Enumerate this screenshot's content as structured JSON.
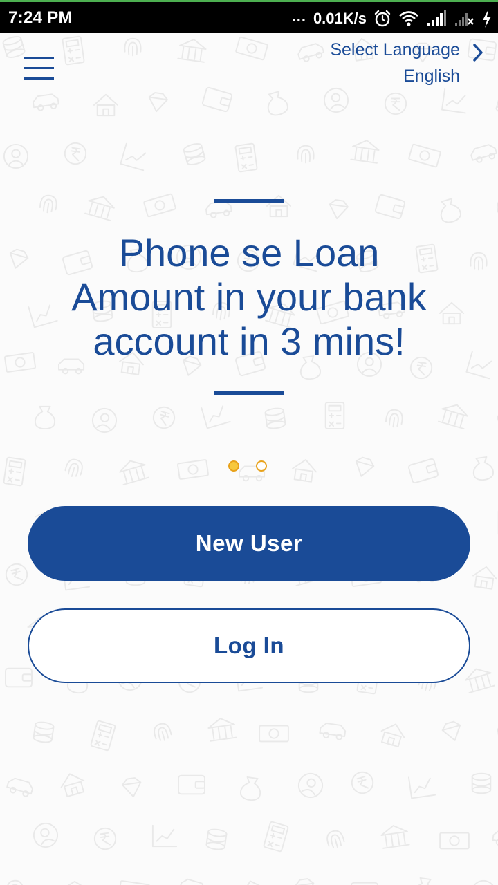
{
  "status_bar": {
    "time": "7:24 PM",
    "dots": "...",
    "net_speed": "0.01K/s",
    "icons": [
      "alarm-icon",
      "wifi-icon",
      "signal-icon",
      "signal-off-icon",
      "charging-icon"
    ]
  },
  "header": {
    "menu_icon": "hamburger-menu-icon",
    "language": {
      "label": "Select Language",
      "value": "English",
      "icon": "chevron-right-icon"
    }
  },
  "hero": {
    "title": "Phone se Loan\nAmount in your bank\naccount in 3 mins!"
  },
  "pager": {
    "total": 2,
    "active_index": 0
  },
  "actions": {
    "new_user_label": "New User",
    "login_label": "Log In"
  },
  "colors": {
    "primary": "#1a4b97",
    "pager_active": "#f7c83d",
    "pager_border": "#e8a21b",
    "background": "#fbfbfb",
    "status_bar": "#000000",
    "status_accent": "#4caf50",
    "pattern": "#e9e9e9"
  }
}
